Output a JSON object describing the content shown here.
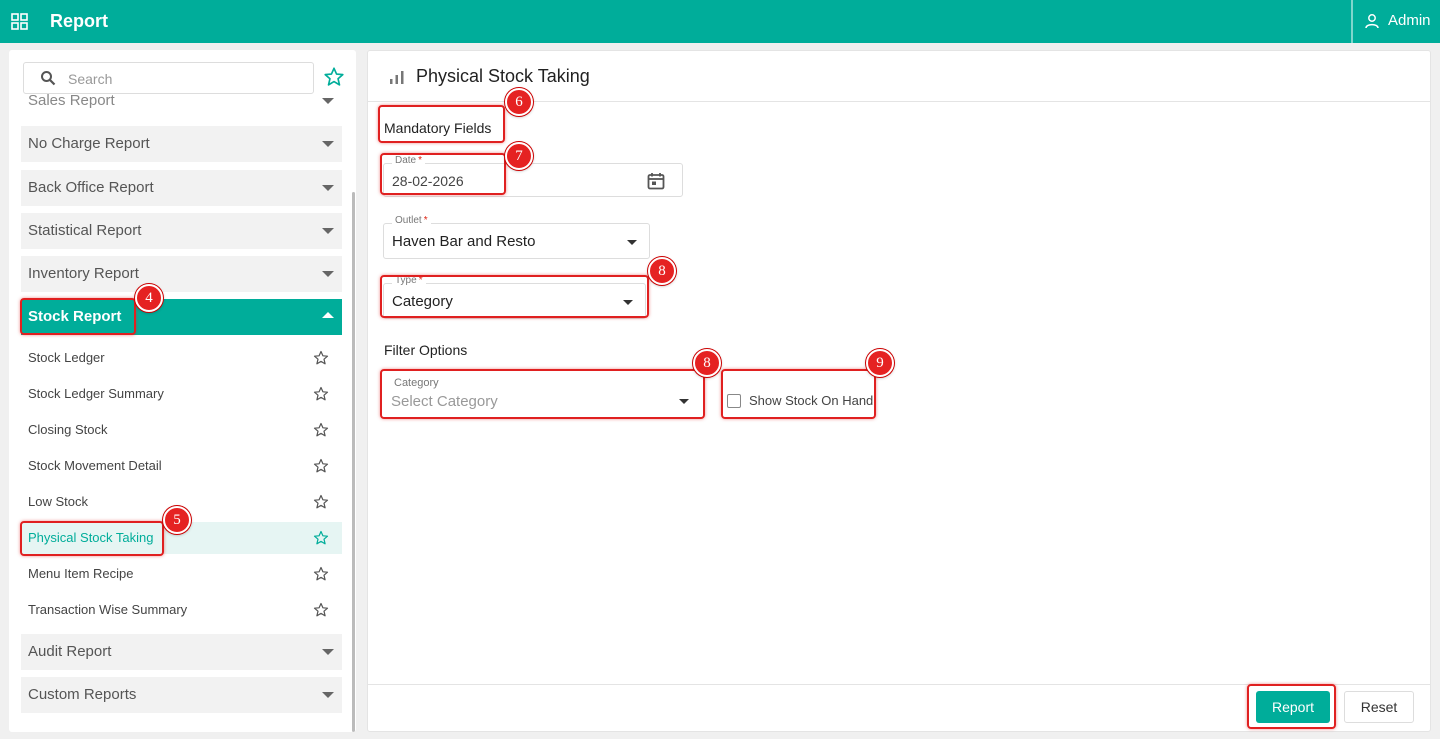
{
  "app": {
    "title": "Report",
    "user": "Admin"
  },
  "sidebar": {
    "search_placeholder": "Search",
    "sections": [
      {
        "label": "Sales Report"
      },
      {
        "label": "No Charge Report"
      },
      {
        "label": "Back Office Report"
      },
      {
        "label": "Statistical Report"
      },
      {
        "label": "Inventory Report"
      },
      {
        "label": "Stock Report"
      },
      {
        "label": "Audit Report"
      },
      {
        "label": "Custom Reports"
      }
    ],
    "items": [
      {
        "label": "Stock Ledger"
      },
      {
        "label": "Stock Ledger Summary"
      },
      {
        "label": "Closing Stock"
      },
      {
        "label": "Stock Movement Detail"
      },
      {
        "label": "Low Stock"
      },
      {
        "label": "Physical Stock Taking"
      },
      {
        "label": "Menu Item Recipe"
      },
      {
        "label": "Transaction Wise Summary"
      }
    ]
  },
  "main": {
    "title": "Physical Stock Taking",
    "mandatory_heading": "Mandatory Fields",
    "date": {
      "label": "Date",
      "required": "*",
      "value": "28-02-2026"
    },
    "outlet": {
      "label": "Outlet",
      "required": "*",
      "value": "Haven Bar and Resto"
    },
    "type": {
      "label": "Type",
      "required": "*",
      "value": "Category"
    },
    "filter_heading": "Filter Options",
    "category": {
      "label": "Category",
      "placeholder": "Select Category"
    },
    "show_stock_on_hand": "Show Stock On Hand",
    "report_button": "Report",
    "reset_button": "Reset"
  },
  "annotations": [
    "4",
    "5",
    "6",
    "7",
    "8",
    "8",
    "9"
  ],
  "colors": {
    "accent": "#00ad9a",
    "annotation": "#e52222"
  }
}
